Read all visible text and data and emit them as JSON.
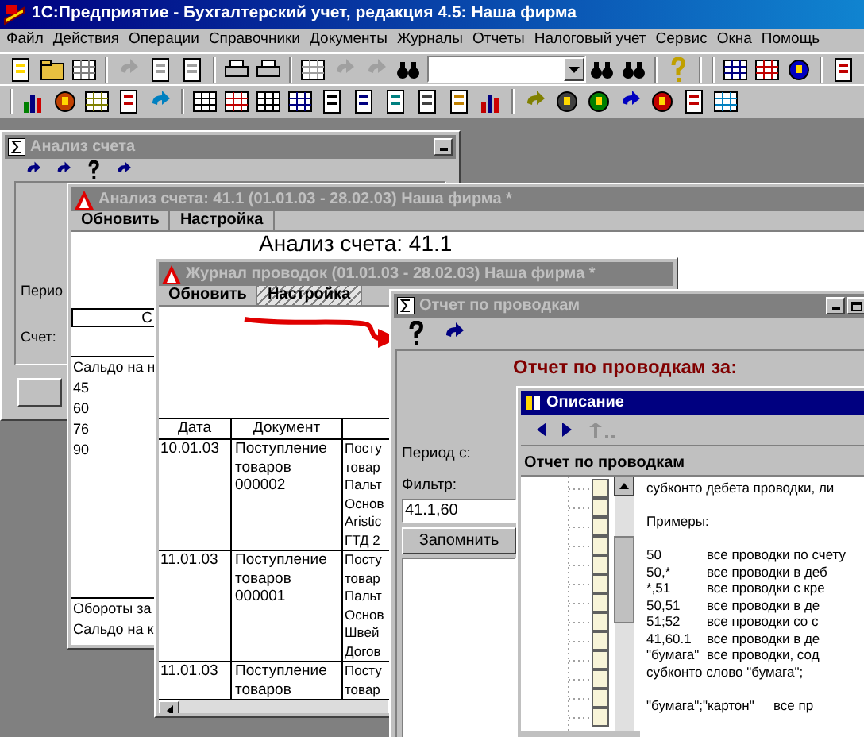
{
  "app": {
    "title": "1С:Предприятие - Бухгалтерский учет, редакция 4.5: Наша фирма",
    "active": true
  },
  "menu": [
    {
      "label": "Файл"
    },
    {
      "label": "Действия"
    },
    {
      "label": "Операции"
    },
    {
      "label": "Справочники"
    },
    {
      "label": "Документы"
    },
    {
      "label": "Журналы"
    },
    {
      "label": "Отчеты"
    },
    {
      "label": "Налоговый учет"
    },
    {
      "label": "Сервис"
    },
    {
      "label": "Окна"
    },
    {
      "label": "Помощь"
    }
  ],
  "account_window": {
    "title": "Анализ счета",
    "active": false,
    "labels": [
      "Перио",
      "Счет:"
    ]
  },
  "report_window": {
    "title": "Анализ счета: 41.1 (01.01.03 - 28.02.03) Наша фирма  *",
    "active": false,
    "buttons": [
      {
        "label": "Обновить",
        "selected": false
      },
      {
        "label": "Настройка",
        "selected": false
      }
    ],
    "heading": "Анализ счета: 41.1",
    "header_cell": "С",
    "rows": [
      "Сальдо на н",
      "45",
      "60",
      "76",
      "90",
      "Обороты за",
      "Сальдо на к"
    ]
  },
  "journal_window": {
    "title": "Журнал проводок (01.01.03 - 28.02.03) Наша фирма  *",
    "active": false,
    "buttons": [
      {
        "label": "Обновить",
        "selected": false
      },
      {
        "label": "Настройка",
        "selected": true
      }
    ],
    "columns": [
      "Дата",
      "Документ"
    ],
    "rows": [
      {
        "date": "10.01.03",
        "document": [
          "Поступление",
          "товаров",
          "000002"
        ],
        "column_3": [
          "Посту",
          "товар",
          "Пальт",
          "Основ",
          "Aristic",
          "ГТД 2"
        ]
      },
      {
        "date": "11.01.03",
        "document": [
          "Поступление",
          "товаров",
          "000001"
        ],
        "column_3": [
          "Посту",
          "товар",
          "Пальт",
          "Основ",
          "Швей",
          "Догов"
        ]
      },
      {
        "date": "11.01.03",
        "document": [
          "Поступление",
          "товаров"
        ],
        "column_3": [
          "Посту",
          "товар"
        ]
      }
    ]
  },
  "postings_window": {
    "title": "Отчет по проводкам",
    "active": false,
    "heading": "Отчет по проводкам за:",
    "period_label": "Период с:",
    "filter_label": "Фильтр:",
    "filter": {
      "value": "41.1,60"
    },
    "remember_button": "Запомнить"
  },
  "help_window": {
    "title": "Описание",
    "active": true,
    "topic": "Отчет по проводкам",
    "intro": "субконто дебета проводки, ли",
    "examples_label": "Примеры:",
    "examples": [
      {
        "pattern": "50",
        "meaning": "все проводки по счету"
      },
      {
        "pattern": "50,*",
        "meaning": "все проводки в деб"
      },
      {
        "pattern": "*,51",
        "meaning": "все проводки с кре"
      },
      {
        "pattern": "50,51",
        "meaning": "все проводки в де"
      },
      {
        "pattern": "51;52",
        "meaning": "все проводки со с"
      },
      {
        "pattern": "41,60.1",
        "meaning": "все проводки в де"
      },
      {
        "pattern": "\"бумага\"",
        "meaning": "все проводки, сод"
      }
    ],
    "note": "субконто слово \"бумага\";",
    "last_example": {
      "pattern": "\"бумага\";\"картон\"",
      "meaning": "все пр"
    }
  }
}
